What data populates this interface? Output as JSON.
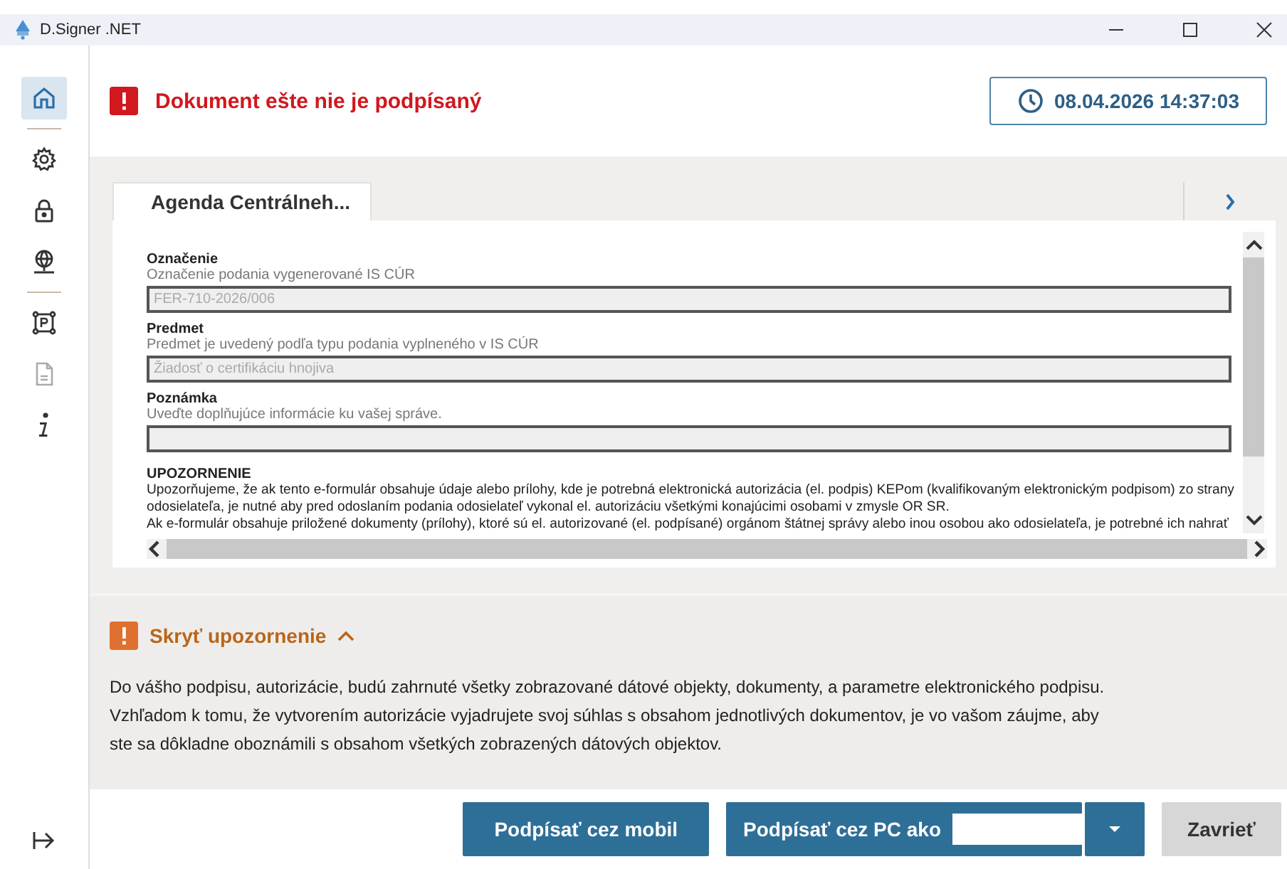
{
  "window": {
    "title": "D.Signer .NET"
  },
  "sidebar": {
    "items": [
      {
        "selected": true,
        "disabled": false
      },
      {
        "selected": false,
        "disabled": false
      },
      {
        "selected": false,
        "disabled": false
      },
      {
        "selected": false,
        "disabled": false
      },
      {
        "selected": false,
        "disabled": false
      },
      {
        "selected": false,
        "disabled": true
      },
      {
        "selected": false,
        "disabled": false
      }
    ]
  },
  "status": {
    "text": "Dokument ešte nie je podpísaný",
    "timestamp": "08.04.2026 14:37:03"
  },
  "tabs": [
    {
      "label": "Agenda Centrálneh...",
      "selected": true
    }
  ],
  "form": {
    "fields": [
      {
        "label": "Označenie",
        "hint": "Označenie podania vygenerované IS CÚR",
        "value": "FER-710-2026/006"
      },
      {
        "label": "Predmet",
        "hint": "Predmet je uvedený podľa typu podania vyplneného v IS CÚR",
        "value": "Žiadosť o certifikáciu hnojiva"
      },
      {
        "label": "Poznámka",
        "hint": "Uveďte doplňujúce informácie ku vašej správe."
      }
    ],
    "notice": {
      "title": "UPOZORNENIE",
      "lines": [
        "Upozorňujeme, že ak tento e-formulár obsahuje údaje alebo prílohy, kde je potrebná elektronická autorizácia (el. podpis) KEPom (kvalifikovaným elektronickým podpisom) zo strany",
        "odosielateľa, je nutné aby pred odoslaním podania odosielateľ vykonal el. autorizáciu všetkými konajúcimi osobami v zmysle OR SR.",
        "Ak e-formulár obsahuje priložené dokumenty (prílohy), ktoré sú el. autorizované (el. podpísané) orgánom štátnej správy alebo inou osobou ako odosielateľa, je potrebné ich nahrať"
      ]
    }
  },
  "warning": {
    "toggle": "Skryť upozornenie",
    "expanded": true,
    "paragraphs": [
      "Do vášho podpisu, autorizácie, budú zahrnuté všetky zobrazované dátové objekty, dokumenty, a parametre elektronického podpisu.",
      "Vzhľadom k tomu, že vytvorením autorizácie vyjadrujete svoj súhlas s obsahom jednotlivých dokumentov, je vo vašom záujme, aby ste sa dôkladne oboznámili s obsahom všetkých zobrazených dátových objektov."
    ]
  },
  "buttons": [
    {
      "label": "Podpísať cez mobil",
      "kind": "primary"
    },
    {
      "label": "Podpísať cez PC ako",
      "kind": "split"
    },
    {
      "label": "Zavrieť",
      "kind": "secondary"
    }
  ]
}
